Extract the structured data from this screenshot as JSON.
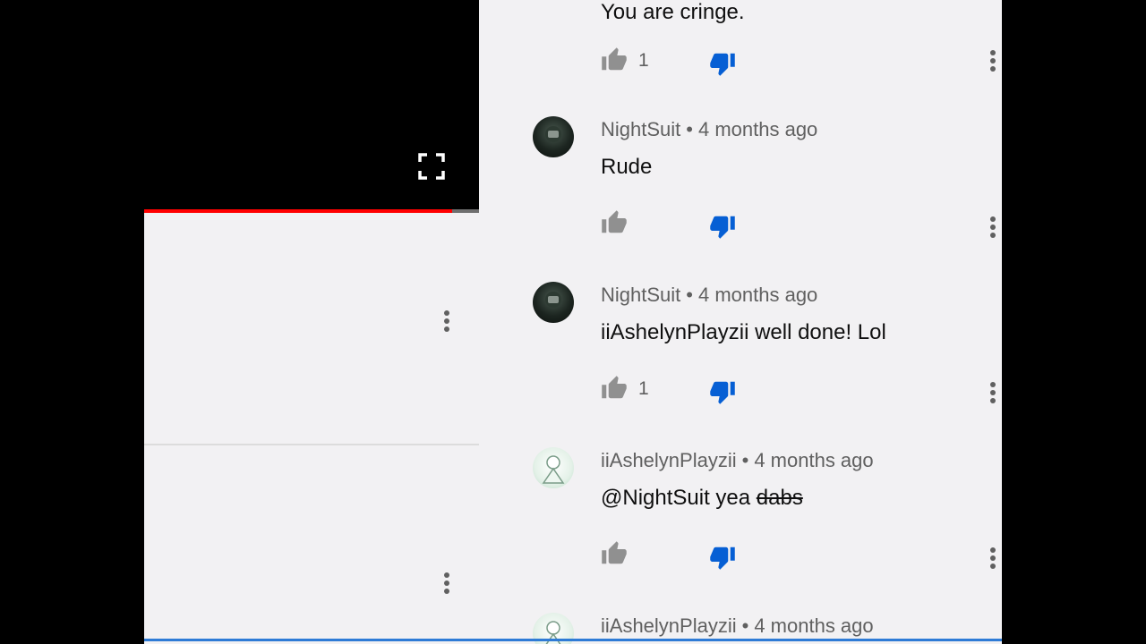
{
  "top_comment": {
    "text": "You are cringe.",
    "likes": "1"
  },
  "video": {
    "progress_percent": 92,
    "fullscreen_icon": "fullscreen-icon"
  },
  "comments": [
    {
      "author": "NightSuit",
      "separator": "•",
      "time": "4 months ago",
      "text": "Rude",
      "likes": "",
      "avatar": "dark"
    },
    {
      "author": "NightSuit",
      "separator": "•",
      "time": "4 months ago",
      "text": "iiAshelynPlayzii well done! Lol",
      "likes": "1",
      "avatar": "dark"
    },
    {
      "author": "iiAshelynPlayzii",
      "separator": "•",
      "time": "4 months ago",
      "text_prefix": "@NightSuit yea",
      "text_struck": "dabs",
      "likes": "",
      "avatar": "light"
    },
    {
      "author": "iiAshelynPlayzii",
      "separator": "•",
      "time": "4 months ago",
      "avatar": "light"
    }
  ],
  "colors": {
    "dislike_active": "#065fd4",
    "like_icon": "#909090",
    "progress": "#ff0000"
  }
}
